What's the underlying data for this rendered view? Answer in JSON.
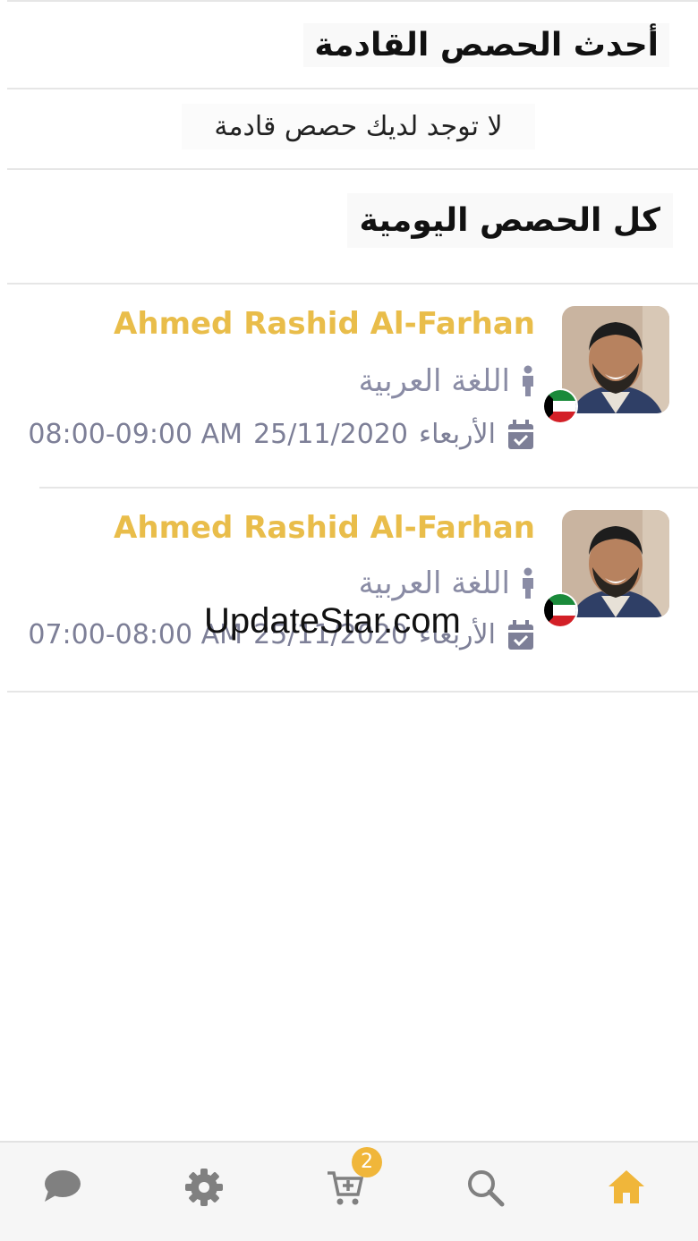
{
  "upcoming": {
    "title": "أحدث الحصص القادمة",
    "empty_message": "لا توجد لديك حصص قادمة"
  },
  "daily": {
    "title": "كل الحصص اليومية",
    "sessions": [
      {
        "teacher": "Ahmed Rashid Al-Farhan",
        "subject": "اللغة العربية",
        "day": "الأربعاء",
        "date": "25/11/2020",
        "time": "08:00-09:00 AM",
        "flag": "kuwait-flag"
      },
      {
        "teacher": "Ahmed Rashid Al-Farhan",
        "subject": "اللغة العربية",
        "day": "الأربعاء",
        "date": "25/11/2020",
        "time": "07:00-08:00 AM",
        "flag": "kuwait-flag"
      }
    ]
  },
  "watermark": "UpdateStar.com",
  "nav": {
    "items": [
      {
        "icon": "chat-icon"
      },
      {
        "icon": "gear-icon"
      },
      {
        "icon": "cart-icon",
        "badge": "2"
      },
      {
        "icon": "search-icon"
      },
      {
        "icon": "home-icon",
        "active": true
      }
    ],
    "active_color": "#f0b63a",
    "inactive_color": "#808080"
  },
  "colors": {
    "name": "#e9bd4a",
    "meta": "#8a8ca5"
  }
}
